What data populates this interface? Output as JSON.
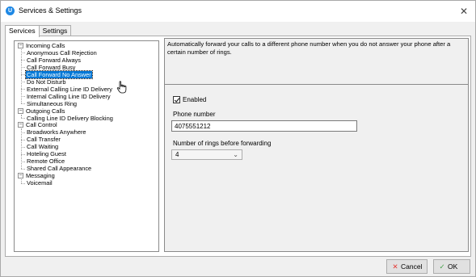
{
  "window": {
    "title": "Services & Settings",
    "icon": "app-logo-icon",
    "close_glyph": "✕"
  },
  "tabs": [
    {
      "label": "Services",
      "active": true
    },
    {
      "label": "Settings",
      "active": false
    }
  ],
  "tree": {
    "groups": [
      {
        "label": "Incoming Calls",
        "expanded": true,
        "items": [
          "Anonymous Call Rejection",
          "Call Forward Always",
          "Call Forward Busy",
          "Call Forward No Answer",
          "Do Not Disturb",
          "External Calling Line ID Delivery",
          "Internal Calling Line ID Delivery",
          "Simultaneous Ring"
        ]
      },
      {
        "label": "Outgoing Calls",
        "expanded": true,
        "items": [
          "Calling Line ID Delivery Blocking"
        ]
      },
      {
        "label": "Call Control",
        "expanded": true,
        "items": [
          "Broadworks Anywhere",
          "Call Transfer",
          "Call Waiting",
          "Hoteling Guest",
          "Remote Office",
          "Shared Call Appearance"
        ]
      },
      {
        "label": "Messaging",
        "expanded": true,
        "items": [
          "Voicemail"
        ]
      }
    ],
    "selected": "Call Forward No Answer",
    "collapse_glyph": "−"
  },
  "description": "Automatically forward your calls to a different phone number when you do not answer your phone after a certain number of rings.",
  "settings": {
    "enabled_label": "Enabled",
    "enabled_checked": true,
    "phone_label": "Phone number",
    "phone_value": "4075551212",
    "rings_label": "Number of rings before forwarding",
    "rings_value": "4",
    "rings_chevron": "⌄"
  },
  "buttons": {
    "cancel_label": "Cancel",
    "cancel_icon": "✕",
    "ok_label": "OK",
    "ok_icon": "✓"
  },
  "colors": {
    "selection": "#0078d7",
    "cancel_icon": "#e53935",
    "ok_icon": "#43a047"
  }
}
